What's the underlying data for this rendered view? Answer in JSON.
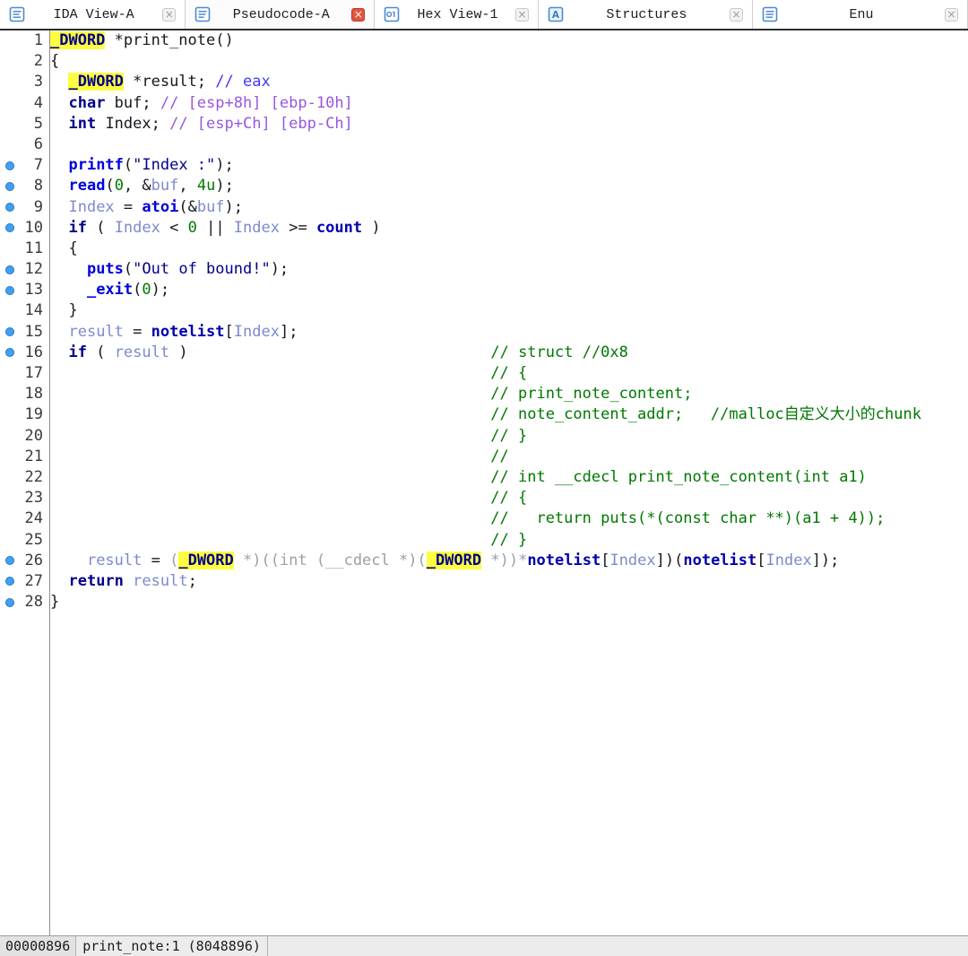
{
  "tab_bar": {
    "tabs": [
      {
        "label": "IDA View-A",
        "icon": "ida-view-icon",
        "active": false
      },
      {
        "label": "Pseudocode-A",
        "icon": "pseudocode-icon",
        "active": true
      },
      {
        "label": "Hex View-1",
        "icon": "hex-view-icon",
        "active": false
      },
      {
        "label": "Structures",
        "icon": "structures-icon",
        "active": false
      },
      {
        "label": "Enu",
        "icon": "enums-icon",
        "active": false
      }
    ]
  },
  "icons": {
    "close_glyph": "×"
  },
  "editor": {
    "comment_column": 48,
    "breakpoint_lines": [
      7,
      8,
      9,
      10,
      12,
      13,
      15,
      16,
      26,
      27,
      28
    ],
    "lines": [
      {
        "n": 1,
        "segs": [
          [
            "hl",
            "_DWORD"
          ],
          [
            "p",
            " *print_note()"
          ]
        ]
      },
      {
        "n": 2,
        "segs": [
          [
            "p",
            "{"
          ]
        ]
      },
      {
        "n": 3,
        "segs": [
          [
            "p",
            "  "
          ],
          [
            "hl",
            "_DWORD"
          ],
          [
            "p",
            " *result; "
          ],
          [
            "cb",
            "// eax"
          ]
        ]
      },
      {
        "n": 4,
        "segs": [
          [
            "p",
            "  "
          ],
          [
            "kw",
            "char"
          ],
          [
            "p",
            " buf; "
          ],
          [
            "cv",
            "// [esp+8h] [ebp-10h]"
          ]
        ]
      },
      {
        "n": 5,
        "segs": [
          [
            "p",
            "  "
          ],
          [
            "kw",
            "int"
          ],
          [
            "p",
            " Index; "
          ],
          [
            "cv",
            "// [esp+Ch] [ebp-Ch]"
          ]
        ]
      },
      {
        "n": 6,
        "segs": []
      },
      {
        "n": 7,
        "segs": [
          [
            "p",
            "  "
          ],
          [
            "fn",
            "printf"
          ],
          [
            "p",
            "("
          ],
          [
            "str",
            "\"Index :\""
          ],
          [
            "p",
            ");"
          ]
        ]
      },
      {
        "n": 8,
        "segs": [
          [
            "p",
            "  "
          ],
          [
            "fn",
            "read"
          ],
          [
            "p",
            "("
          ],
          [
            "num",
            "0"
          ],
          [
            "p",
            ", &"
          ],
          [
            "var",
            "buf"
          ],
          [
            "p",
            ", "
          ],
          [
            "num",
            "4u"
          ],
          [
            "p",
            ");"
          ]
        ]
      },
      {
        "n": 9,
        "segs": [
          [
            "p",
            "  "
          ],
          [
            "var",
            "Index"
          ],
          [
            "p",
            " = "
          ],
          [
            "fn",
            "atoi"
          ],
          [
            "p",
            "(&"
          ],
          [
            "var",
            "buf"
          ],
          [
            "p",
            ");"
          ]
        ]
      },
      {
        "n": 10,
        "segs": [
          [
            "p",
            "  "
          ],
          [
            "kw",
            "if"
          ],
          [
            "p",
            " ( "
          ],
          [
            "var",
            "Index"
          ],
          [
            "p",
            " < "
          ],
          [
            "num",
            "0"
          ],
          [
            "p",
            " || "
          ],
          [
            "var",
            "Index"
          ],
          [
            "p",
            " >= "
          ],
          [
            "glob",
            "count"
          ],
          [
            "p",
            " )"
          ]
        ]
      },
      {
        "n": 11,
        "segs": [
          [
            "p",
            "  {"
          ]
        ]
      },
      {
        "n": 12,
        "segs": [
          [
            "p",
            "    "
          ],
          [
            "fn",
            "puts"
          ],
          [
            "p",
            "("
          ],
          [
            "str",
            "\"Out of bound!\""
          ],
          [
            "p",
            ");"
          ]
        ]
      },
      {
        "n": 13,
        "segs": [
          [
            "p",
            "    "
          ],
          [
            "fn",
            "_exit"
          ],
          [
            "p",
            "("
          ],
          [
            "num",
            "0"
          ],
          [
            "p",
            ");"
          ]
        ]
      },
      {
        "n": 14,
        "segs": [
          [
            "p",
            "  }"
          ]
        ]
      },
      {
        "n": 15,
        "segs": [
          [
            "p",
            "  "
          ],
          [
            "var",
            "result"
          ],
          [
            "p",
            " = "
          ],
          [
            "glob",
            "notelist"
          ],
          [
            "p",
            "["
          ],
          [
            "var",
            "Index"
          ],
          [
            "p",
            "];"
          ]
        ]
      },
      {
        "n": 16,
        "segs": [
          [
            "p",
            "  "
          ],
          [
            "kw",
            "if"
          ],
          [
            "p",
            " ( "
          ],
          [
            "var",
            "result"
          ],
          [
            "p",
            " )"
          ]
        ],
        "comment": {
          "style": "cg",
          "text": "// struct //0x8"
        }
      },
      {
        "n": 17,
        "segs": [],
        "comment": {
          "style": "cg",
          "text": "// {"
        }
      },
      {
        "n": 18,
        "segs": [],
        "comment": {
          "style": "cg",
          "text": "// print_note_content;"
        }
      },
      {
        "n": 19,
        "segs": [],
        "comment": {
          "style": "cg",
          "text": "// note_content_addr;   //malloc自定义大小的chunk"
        }
      },
      {
        "n": 20,
        "segs": [],
        "comment": {
          "style": "cg",
          "text": "// }"
        }
      },
      {
        "n": 21,
        "segs": [],
        "comment": {
          "style": "cg",
          "text": "//"
        }
      },
      {
        "n": 22,
        "segs": [],
        "comment": {
          "style": "cg",
          "text": "// int __cdecl print_note_content(int a1)"
        }
      },
      {
        "n": 23,
        "segs": [],
        "comment": {
          "style": "cg",
          "text": "// {"
        }
      },
      {
        "n": 24,
        "segs": [],
        "comment": {
          "style": "cg",
          "text": "//   return puts(*(const char **)(a1 + 4));"
        }
      },
      {
        "n": 25,
        "segs": [],
        "comment": {
          "style": "cg",
          "text": "// }"
        }
      },
      {
        "n": 26,
        "segs": [
          [
            "p",
            "    "
          ],
          [
            "var",
            "result"
          ],
          [
            "p",
            " = "
          ],
          [
            "cast",
            "("
          ],
          [
            "hl",
            "_DWORD"
          ],
          [
            "cast",
            " *)((int (__cdecl *)("
          ],
          [
            "hl",
            "_DWORD"
          ],
          [
            "cast",
            " *))*"
          ],
          [
            "glob",
            "notelist"
          ],
          [
            "p",
            "["
          ],
          [
            "var",
            "Index"
          ],
          [
            "p",
            "])("
          ],
          [
            "glob",
            "notelist"
          ],
          [
            "p",
            "["
          ],
          [
            "var",
            "Index"
          ],
          [
            "p",
            "]);"
          ]
        ]
      },
      {
        "n": 27,
        "segs": [
          [
            "p",
            "  "
          ],
          [
            "kw",
            "return"
          ],
          [
            "p",
            " "
          ],
          [
            "var",
            "result"
          ],
          [
            "p",
            ";"
          ]
        ]
      },
      {
        "n": 28,
        "segs": [
          [
            "p",
            "}"
          ]
        ]
      }
    ]
  },
  "status_bar": {
    "address": "00000896",
    "location": "print_note:1 (8048896)"
  },
  "colors": {
    "plain": "#17171f",
    "keyword": "#000089",
    "function_name": "#0000dc",
    "local_var": "#7e89cf",
    "global_var": "#0000ad",
    "string": "#000089",
    "number": "#007800",
    "comment_blue": "#3b3bff",
    "comment_violet": "#9757e0",
    "comment_green": "#007800",
    "cast_gray": "#9aa0a8",
    "highlight_bg": "#fdfd42",
    "breakpoint": "#42a0ee",
    "tab_close_active": "#e2543f",
    "tab_icon_blue": "#4d8ad0"
  }
}
